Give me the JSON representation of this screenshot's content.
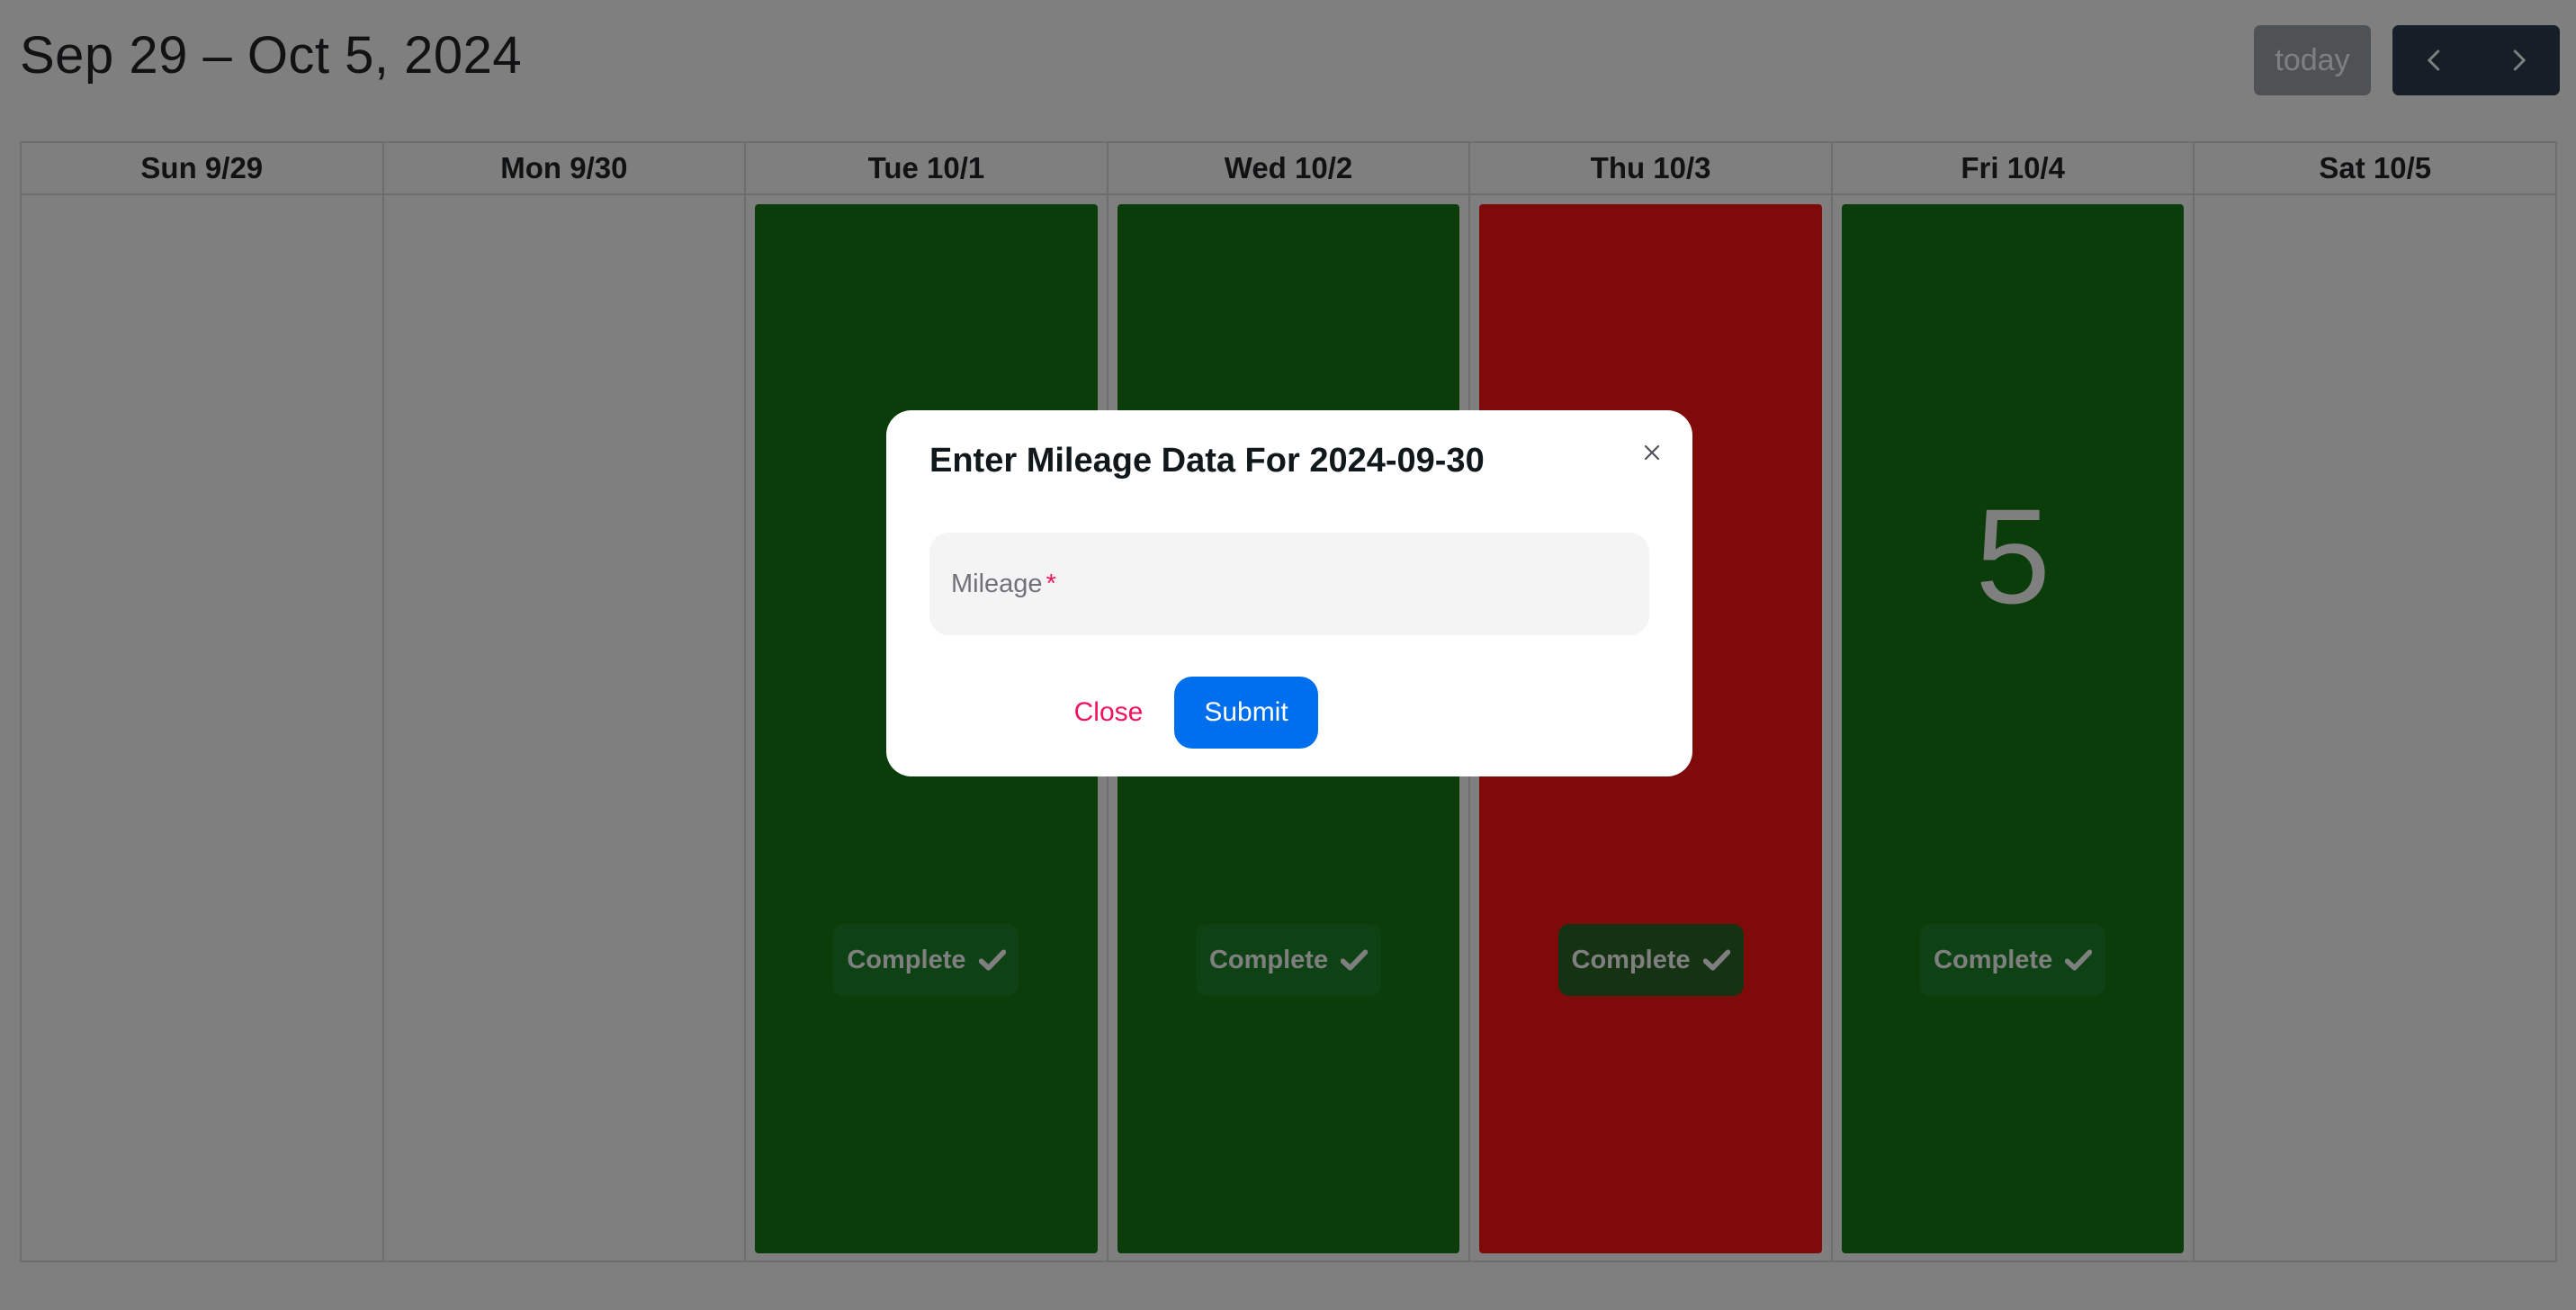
{
  "header": {
    "title": "Sep 29 – Oct 5, 2024",
    "today_label": "today",
    "prev_icon": "chevron-left-icon",
    "next_icon": "chevron-right-icon"
  },
  "calendar": {
    "days": [
      {
        "label": "Sun 9/29"
      },
      {
        "label": "Mon 9/30"
      },
      {
        "label": "Tue 10/1"
      },
      {
        "label": "Wed 10/2"
      },
      {
        "label": "Thu 10/3"
      },
      {
        "label": "Fri 10/4"
      },
      {
        "label": "Sat 10/5"
      }
    ],
    "events": [
      {
        "day": "Tue 10/1",
        "status_color": "#147a14",
        "badge": "Complete",
        "count": ""
      },
      {
        "day": "Wed 10/2",
        "status_color": "#147a14",
        "badge": "Complete",
        "count": ""
      },
      {
        "day": "Thu 10/3",
        "status_color": "#ff1414",
        "badge": "Complete",
        "count": ""
      },
      {
        "day": "Fri 10/4",
        "status_color": "#147a14",
        "badge": "Complete",
        "count": "5"
      }
    ]
  },
  "modal": {
    "title": "Enter Mileage Data For 2024-09-30",
    "field_label": "Mileage",
    "required_marker": "*",
    "field_value": "",
    "close_label": "Close",
    "submit_label": "Submit"
  },
  "colors": {
    "accent": "#006fee",
    "danger": "#f31260",
    "complete_green": "#147a14",
    "incomplete_red": "#ff1414"
  }
}
